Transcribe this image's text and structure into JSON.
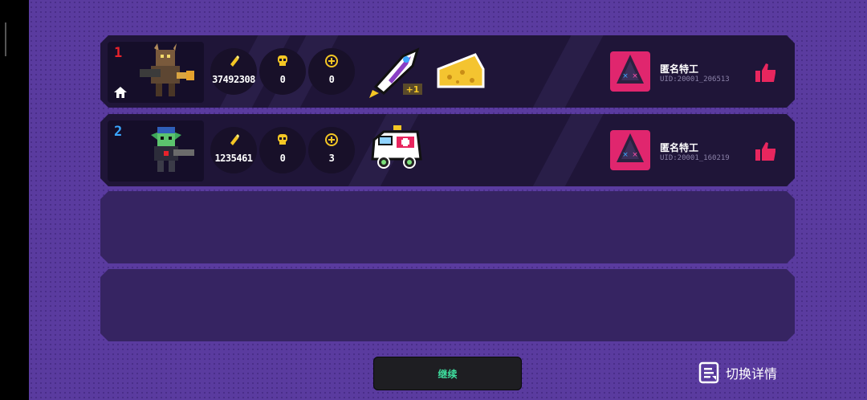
{
  "players": [
    {
      "rank": "1",
      "coins": "37492308",
      "kills": "0",
      "bonus": "0",
      "is_host": true,
      "items": [
        "rocket-plus-one-icon",
        "cheese-icon"
      ],
      "name": "匿名特工",
      "uid": "UID:20001_206513"
    },
    {
      "rank": "2",
      "coins": "1235461",
      "kills": "0",
      "bonus": "3",
      "is_host": false,
      "items": [
        "ambulance-icon"
      ],
      "name": "匿名特工",
      "uid": "UID:20001_160219"
    }
  ],
  "continue_label": "继续",
  "switch_details_label": "切换详情",
  "colors": {
    "background": "#5a3a9e",
    "row": "#1f1538",
    "empty_row": "#362462",
    "accent_like": "#e8265e",
    "continue_text": "#3fe0a0"
  }
}
